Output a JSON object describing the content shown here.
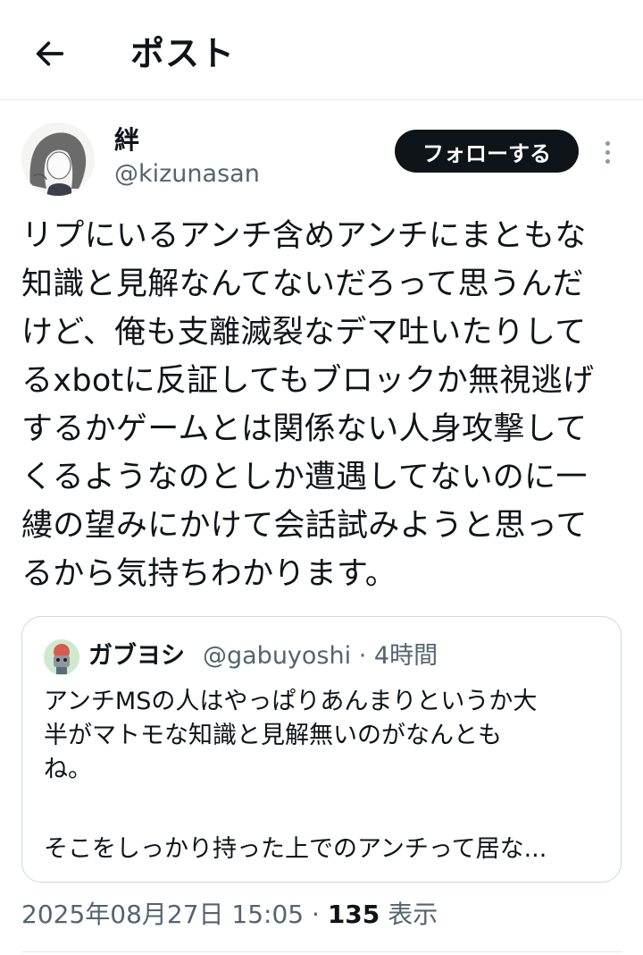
{
  "header": {
    "title": "ポスト"
  },
  "author": {
    "display_name": "絆",
    "handle": "@kizunasan",
    "follow_label": "フォローする"
  },
  "tweet": {
    "text": "リプにいるアンチ含めアンチにまともな\n知識と見解なんてないだろって思うんだ\nけど、俺も支離滅裂なデマ吐いたりして\nるxbotに反証してもブロックか無視逃げ\nするかゲームとは関係ない人身攻撃して\nくるようなのとしか遭遇してないのに一\n縷の望みにかけて会話試みようと思って\nるから気持ちわかります。"
  },
  "quote": {
    "display_name": "ガブヨシ",
    "handle": "@gabuyoshi",
    "separator": "·",
    "time": "4時間",
    "text": "アンチMSの人はやっぱりあんまりというか大\n半がマトモな知識と見解無いのがなんとも\nね。",
    "text_more": "そこをしっかり持った上でのアンチって居な..."
  },
  "meta": {
    "timestamp": "2025年08月27日 15:05",
    "separator": "·",
    "views_count": "135",
    "views_label": "表示"
  },
  "icons": {
    "back": "arrow-left-icon",
    "more": "more-vertical-icon"
  }
}
